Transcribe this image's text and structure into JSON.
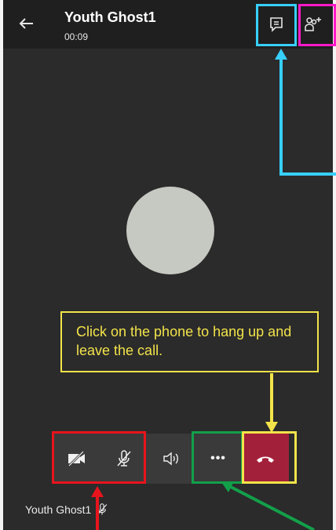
{
  "call": {
    "title": "Youth Ghost1",
    "timer": "00:09"
  },
  "callout": {
    "text": "Click on the phone to hang up and leave the call."
  },
  "controls": {
    "camera": "camera-off",
    "mic": "mic-off",
    "speaker": "speaker",
    "more_label": "•••",
    "hangup": "phone-hangup"
  },
  "self_view": {
    "name": "Youth Ghost1"
  },
  "colors": {
    "annotation_red": "#e8141c",
    "annotation_green": "#12a04a",
    "annotation_yellow": "#f2e34a",
    "annotation_cyan": "#37d0ff",
    "annotation_magenta": "#ff19c8",
    "hangup": "#a3203a"
  }
}
